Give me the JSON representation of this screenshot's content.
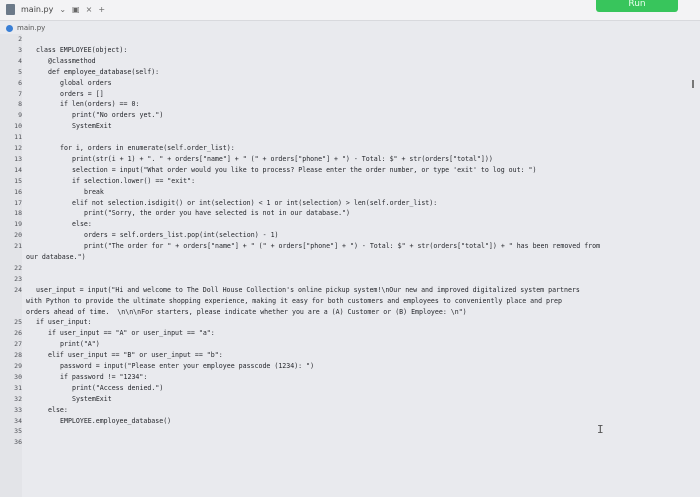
{
  "tab": {
    "filename": "main.py",
    "chevron": "⌄",
    "box": "▣",
    "close": "×",
    "plus": "+"
  },
  "run_label": "Run",
  "breadcrumb": "main.py",
  "lines": [
    {
      "n": "2",
      "text": ""
    },
    {
      "n": "3",
      "text": "class EMPLOYEE(object):",
      "indent": 0
    },
    {
      "n": "4",
      "text": "@classmethod",
      "indent": 1
    },
    {
      "n": "5",
      "text": "def employee_database(self):",
      "indent": 1
    },
    {
      "n": "6",
      "text": "global orders",
      "indent": 2
    },
    {
      "n": "7",
      "text": "orders = []",
      "indent": 2
    },
    {
      "n": "8",
      "text": "if len(orders) == 0:",
      "indent": 2
    },
    {
      "n": "9",
      "text": "print(\"No orders yet.\")",
      "indent": 3
    },
    {
      "n": "10",
      "text": "SystemExit",
      "indent": 3
    },
    {
      "n": "11",
      "text": ""
    },
    {
      "n": "12",
      "text": "for i, orders in enumerate(self.order_list):",
      "indent": 2
    },
    {
      "n": "13",
      "text": "print(str(i + 1) + \". \" + orders[\"name\"] + \" (\" + orders[\"phone\"] + \") - Total: $\" + str(orders[\"total\"]))",
      "indent": 3
    },
    {
      "n": "14",
      "text": "selection = input(\"What order would you like to process? Please enter the order number, or type 'exit' to log out: \")",
      "indent": 3
    },
    {
      "n": "15",
      "text": "if selection.lower() == \"exit\":",
      "indent": 3
    },
    {
      "n": "16",
      "text": "break",
      "indent": 4
    },
    {
      "n": "17",
      "text": "elif not selection.isdigit() or int(selection) < 1 or int(selection) > len(self.order_list):",
      "indent": 3
    },
    {
      "n": "18",
      "text": "print(\"Sorry, the order you have selected is not in our database.\")",
      "indent": 4
    },
    {
      "n": "19",
      "text": "else:",
      "indent": 3
    },
    {
      "n": "20",
      "text": "orders = self.orders_list.pop(int(selection) - 1)",
      "indent": 4
    },
    {
      "n": "21",
      "text": "print(\"The order for \" + orders[\"name\"] + \" (\" + orders[\"phone\"] + \") - Total: $\" + str(orders[\"total\"]) + \" has been removed from",
      "indent": 4
    },
    {
      "n": "",
      "text": "our database.\")",
      "wrap": true
    },
    {
      "n": "22",
      "text": ""
    },
    {
      "n": "23",
      "text": ""
    },
    {
      "n": "24",
      "text": "user_input = input(\"Hi and welcome to The Doll House Collection's online pickup system!\\nOur new and improved digitalized system partners",
      "indent": 0
    },
    {
      "n": "",
      "text": "with Python to provide the ultimate shopping experience, making it easy for both customers and employees to conveniently place and prep",
      "wrap": true
    },
    {
      "n": "",
      "text": "orders ahead of time.  \\n\\n\\nFor starters, please indicate whether you are a (A) Customer or (B) Employee: \\n\")",
      "wrap": true
    },
    {
      "n": "25",
      "text": "if user_input:",
      "indent": 0
    },
    {
      "n": "26",
      "text": "if user_input == \"A\" or user_input == \"a\":",
      "indent": 1
    },
    {
      "n": "27",
      "text": "print(\"A\")",
      "indent": 2
    },
    {
      "n": "28",
      "text": "elif user_input == \"B\" or user_input == \"b\":",
      "indent": 1
    },
    {
      "n": "29",
      "text": "password = input(\"Please enter your employee passcode (1234): \")",
      "indent": 2
    },
    {
      "n": "30",
      "text": "if password != \"1234\":",
      "indent": 2
    },
    {
      "n": "31",
      "text": "print(\"Access denied.\")",
      "indent": 3
    },
    {
      "n": "32",
      "text": "SystemExit",
      "indent": 3
    },
    {
      "n": "33",
      "text": "else:",
      "indent": 1
    },
    {
      "n": "34",
      "text": "EMPLOYEE.employee_database()",
      "indent": 2
    },
    {
      "n": "35",
      "text": ""
    },
    {
      "n": "36",
      "text": ""
    }
  ]
}
